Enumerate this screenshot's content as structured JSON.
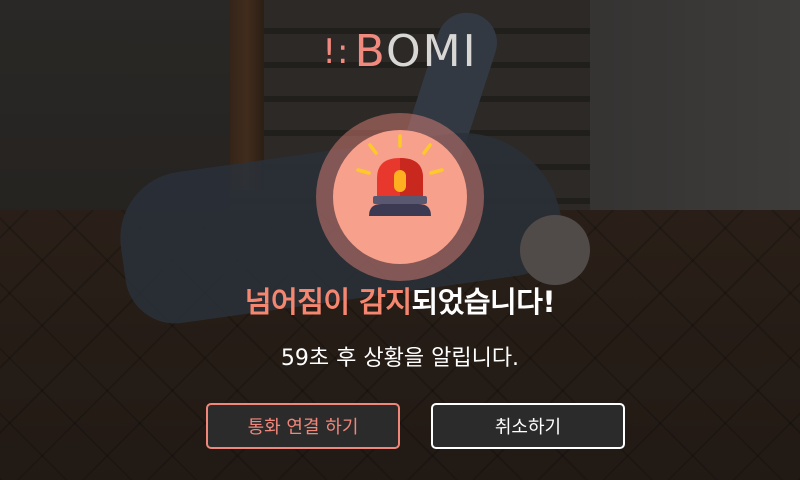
{
  "logo": {
    "mark": "!:",
    "b": "B",
    "rest": "OMI"
  },
  "alert": {
    "icon": "siren-icon",
    "headline_accent": "넘어짐이 감지",
    "headline_rest": "되었습니다!",
    "subline": "59초 후 상황을 알립니다."
  },
  "buttons": {
    "call_label": "통화 연결 하기",
    "cancel_label": "취소하기"
  },
  "colors": {
    "accent": "#f0877a",
    "icon_bg": "#f7a08c",
    "siren_red": "#e8382e",
    "siren_base": "#3b3a52",
    "rays": "#ffc928"
  }
}
